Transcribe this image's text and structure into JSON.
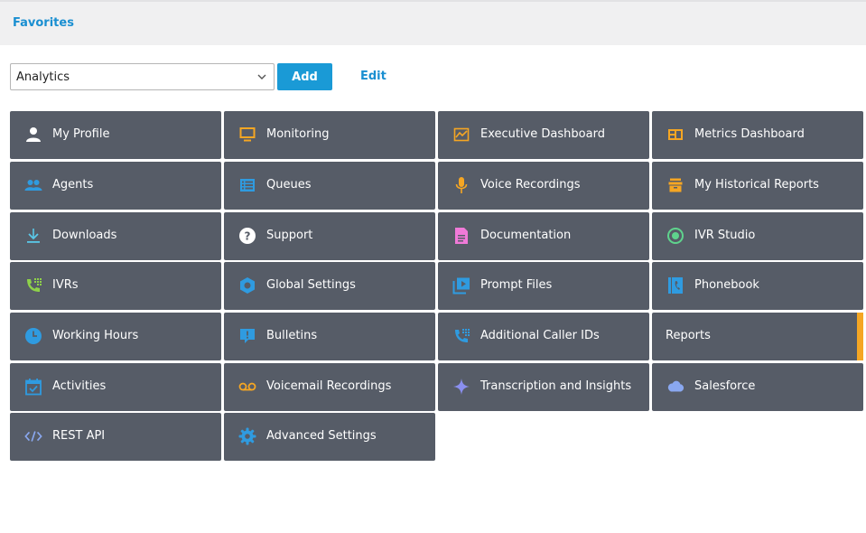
{
  "header": {
    "title": "Favorites"
  },
  "toolbar": {
    "select_value": "Analytics",
    "add_label": "Add",
    "edit_label": "Edit"
  },
  "tiles": [
    {
      "label": "My Profile",
      "icon": "user-icon",
      "color": "#ffffff"
    },
    {
      "label": "Monitoring",
      "icon": "monitor-icon",
      "color": "#f5a623"
    },
    {
      "label": "Executive Dashboard",
      "icon": "chart-line-icon",
      "color": "#f5a623"
    },
    {
      "label": "Metrics Dashboard",
      "icon": "dashboard-icon",
      "color": "#f5a623"
    },
    {
      "label": "Agents",
      "icon": "users-icon",
      "color": "#2f9be0"
    },
    {
      "label": "Queues",
      "icon": "list-icon",
      "color": "#2f9be0"
    },
    {
      "label": "Voice Recordings",
      "icon": "microphone-icon",
      "color": "#f5a623"
    },
    {
      "label": "My Historical Reports",
      "icon": "archive-icon",
      "color": "#f5a623"
    },
    {
      "label": "Downloads",
      "icon": "download-icon",
      "color": "#5ac8e8"
    },
    {
      "label": "Support",
      "icon": "help-icon",
      "color": "#ffffff"
    },
    {
      "label": "Documentation",
      "icon": "document-icon",
      "color": "#f07ad8"
    },
    {
      "label": "IVR Studio",
      "icon": "radio-icon",
      "color": "#5fd38d"
    },
    {
      "label": "IVRs",
      "icon": "phone-dialpad-icon",
      "color": "#8ed14a"
    },
    {
      "label": "Global Settings",
      "icon": "hexagon-settings-icon",
      "color": "#2f9be0"
    },
    {
      "label": "Prompt Files",
      "icon": "media-file-icon",
      "color": "#2f9be0"
    },
    {
      "label": "Phonebook",
      "icon": "phonebook-icon",
      "color": "#2f9be0"
    },
    {
      "label": "Working Hours",
      "icon": "clock-icon",
      "color": "#2f9be0"
    },
    {
      "label": "Bulletins",
      "icon": "message-alert-icon",
      "color": "#2f9be0"
    },
    {
      "label": "Additional Caller IDs",
      "icon": "phone-dialpad-icon",
      "color": "#2f9be0"
    },
    {
      "label": "Reports",
      "icon": "",
      "color": "#f5a623"
    },
    {
      "label": "Activities",
      "icon": "calendar-check-icon",
      "color": "#2f9be0"
    },
    {
      "label": "Voicemail Recordings",
      "icon": "voicemail-icon",
      "color": "#f5a623"
    },
    {
      "label": "Transcription and Insights",
      "icon": "sparkle-icon",
      "color": "#8a8ff0"
    },
    {
      "label": "Salesforce",
      "icon": "cloud-icon",
      "color": "#8aa8f0"
    },
    {
      "label": "REST API",
      "icon": "code-icon",
      "color": "#8aa8f0"
    },
    {
      "label": "Advanced Settings",
      "icon": "gear-icon",
      "color": "#2f9be0"
    }
  ]
}
